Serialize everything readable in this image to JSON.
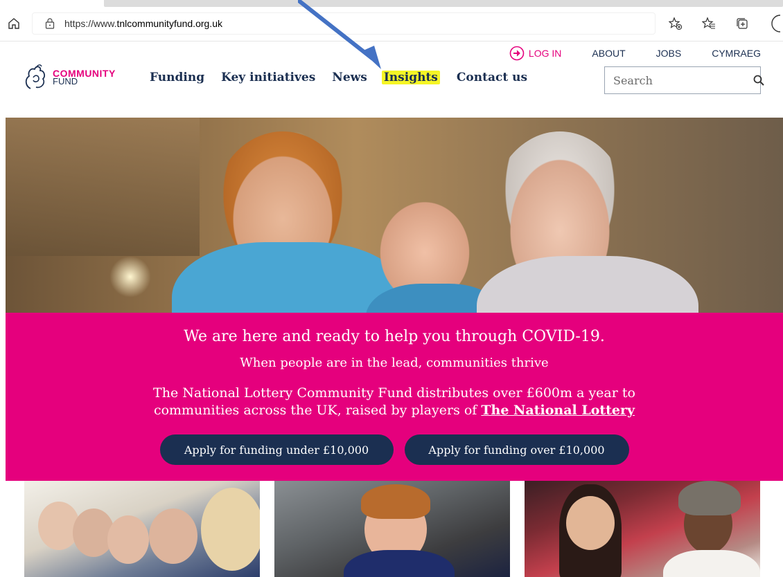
{
  "browser": {
    "url_prefix": "https://www.",
    "url_host": "tnlcommunityfund.org.uk"
  },
  "logo": {
    "line1": "COMMUNITY",
    "line2": "FUND"
  },
  "nav": {
    "items": [
      {
        "label": "Funding"
      },
      {
        "label": "Key initiatives"
      },
      {
        "label": "News"
      },
      {
        "label": "Insights",
        "highlighted": true
      },
      {
        "label": "Contact us"
      }
    ]
  },
  "utility_nav": {
    "login": "LOG IN",
    "about": "ABOUT",
    "jobs": "JOBS",
    "cymraeg": "CYMRAEG"
  },
  "search": {
    "placeholder": "Search"
  },
  "banner": {
    "title": "We are here and ready to help you through COVID-19.",
    "tagline": "When people are in the lead, communities thrive",
    "description_part1": "The National Lottery Community Fund distributes over £600m a year to",
    "description_part2": "communities across the UK, raised by players of ",
    "description_link": "The National Lottery",
    "cta_under": "Apply for funding under £10,000",
    "cta_over": "Apply for funding over £10,000"
  },
  "colors": {
    "brand_pink": "#e5007d",
    "navy": "#1b2f51",
    "highlight_yellow": "#f5f526",
    "annotation_blue": "#4472c4"
  },
  "icons": {
    "home": "home-icon",
    "lock": "lock-icon",
    "favorite_add": "star-plus-icon",
    "favorites": "favorites-icon",
    "collections": "collections-icon",
    "login": "login-arrow-icon",
    "search": "search-icon"
  }
}
